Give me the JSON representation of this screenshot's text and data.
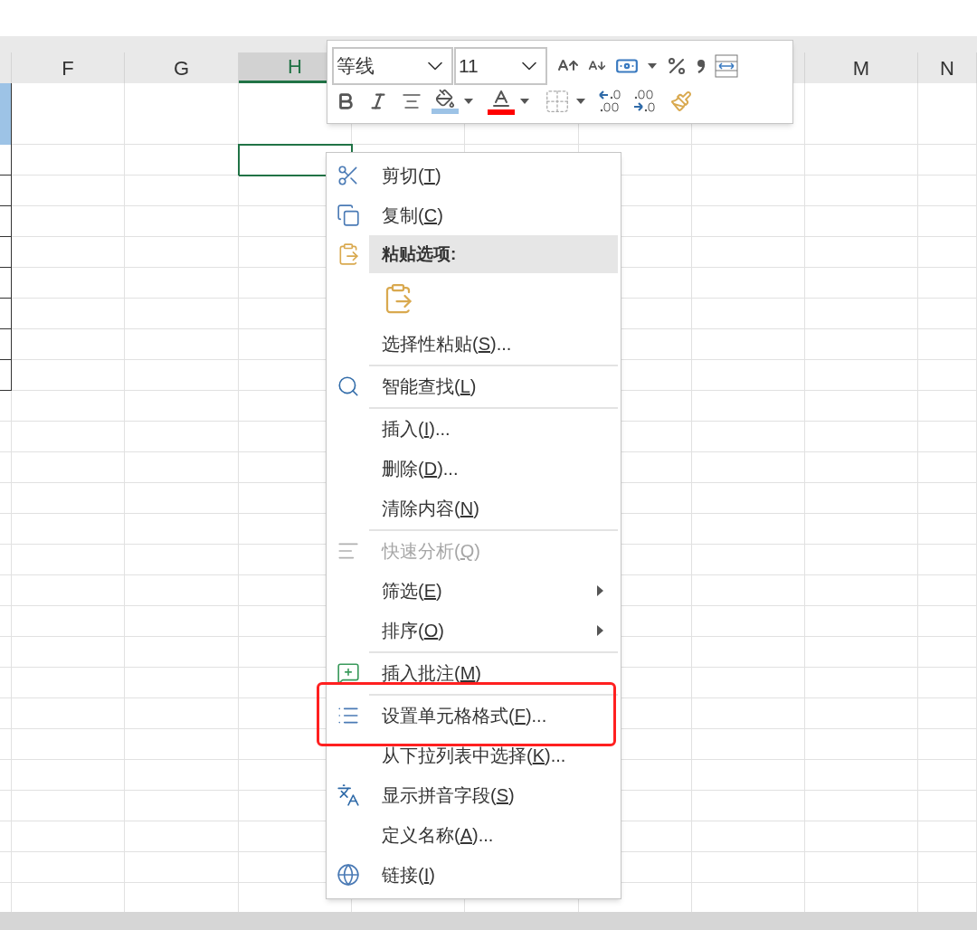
{
  "columns": [
    {
      "label": "F",
      "selected": false
    },
    {
      "label": "G",
      "selected": false
    },
    {
      "label": "H",
      "selected": true
    },
    {
      "label": "M",
      "selected": false
    },
    {
      "label": "N",
      "selected": false
    }
  ],
  "toolbar": {
    "font": {
      "value": "等线"
    },
    "size": {
      "value": "11"
    }
  },
  "context_menu": {
    "items": [
      {
        "kind": "command",
        "before": "剪切(",
        "key": "T",
        "after": ")",
        "disabled": false,
        "submenu": false,
        "highlighted": false
      },
      {
        "kind": "command",
        "before": "复制(",
        "key": "C",
        "after": ")",
        "disabled": false,
        "submenu": false,
        "highlighted": false
      },
      {
        "kind": "header",
        "text": "粘贴选项:"
      },
      {
        "kind": "paste_options"
      },
      {
        "kind": "command",
        "before": "选择性粘贴(",
        "key": "S",
        "after": ")...",
        "disabled": false,
        "submenu": false,
        "highlighted": false
      },
      {
        "kind": "separator"
      },
      {
        "kind": "command",
        "before": "智能查找(",
        "key": "L",
        "after": ")",
        "disabled": false,
        "submenu": false,
        "highlighted": false
      },
      {
        "kind": "separator"
      },
      {
        "kind": "command",
        "before": "插入(",
        "key": "I",
        "after": ")...",
        "disabled": false,
        "submenu": false,
        "highlighted": false
      },
      {
        "kind": "command",
        "before": "删除(",
        "key": "D",
        "after": ")...",
        "disabled": false,
        "submenu": false,
        "highlighted": false
      },
      {
        "kind": "command",
        "before": "清除内容(",
        "key": "N",
        "after": ")",
        "disabled": false,
        "submenu": false,
        "highlighted": false
      },
      {
        "kind": "separator"
      },
      {
        "kind": "command",
        "before": "快速分析(",
        "key": "Q",
        "after": ")",
        "disabled": true,
        "submenu": false,
        "highlighted": false
      },
      {
        "kind": "command",
        "before": "筛选(",
        "key": "E",
        "after": ")",
        "disabled": false,
        "submenu": true,
        "highlighted": false
      },
      {
        "kind": "command",
        "before": "排序(",
        "key": "O",
        "after": ")",
        "disabled": false,
        "submenu": true,
        "highlighted": false
      },
      {
        "kind": "separator"
      },
      {
        "kind": "command",
        "before": "插入批注(",
        "key": "M",
        "after": ")",
        "disabled": false,
        "submenu": false,
        "highlighted": false
      },
      {
        "kind": "separator"
      },
      {
        "kind": "command",
        "before": "设置单元格格式(",
        "key": "F",
        "after": ")...",
        "disabled": false,
        "submenu": false,
        "highlighted": true
      },
      {
        "kind": "command",
        "before": "从下拉列表中选择(",
        "key": "K",
        "after": ")...",
        "disabled": false,
        "submenu": false,
        "highlighted": false
      },
      {
        "kind": "command",
        "before": "显示拼音字段(",
        "key": "S",
        "after": ")",
        "disabled": false,
        "submenu": false,
        "highlighted": false
      },
      {
        "kind": "command",
        "before": "定义名称(",
        "key": "A",
        "after": ")...",
        "disabled": false,
        "submenu": false,
        "highlighted": false
      },
      {
        "kind": "command",
        "before": "链接(",
        "key": "I",
        "after": ")",
        "disabled": false,
        "submenu": false,
        "highlighted": false
      }
    ]
  }
}
